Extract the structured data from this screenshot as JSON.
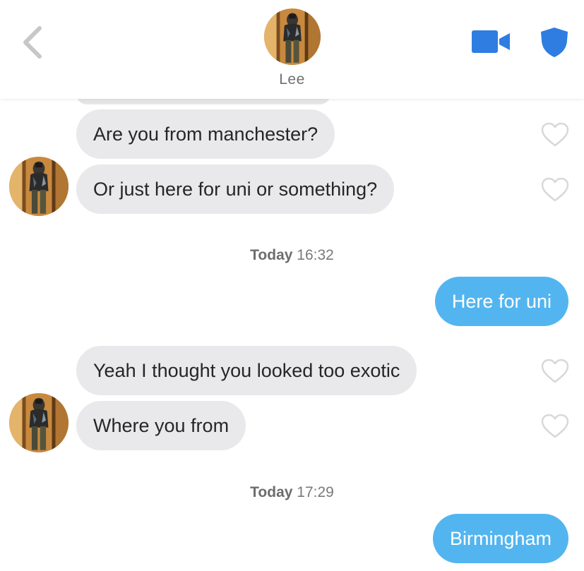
{
  "header": {
    "contact_name": "Lee",
    "back_icon": "chevron-left-icon",
    "video_icon": "video-camera-icon",
    "shield_icon": "shield-icon",
    "accent_color": "#2f7de1"
  },
  "messages": [
    {
      "from": "them",
      "text": "Are you from manchester?"
    },
    {
      "from": "them",
      "text": "Or just here for uni or something?"
    },
    {
      "type": "timestamp",
      "day": "Today",
      "time": "16:32"
    },
    {
      "from": "me",
      "text": "Here for uni"
    },
    {
      "from": "them",
      "text": "Yeah I thought you looked too exotic"
    },
    {
      "from": "them",
      "text": "Where you from"
    },
    {
      "type": "timestamp",
      "day": "Today",
      "time": "17:29"
    },
    {
      "from": "me",
      "text": "Birmingham"
    }
  ],
  "colors": {
    "incoming_bubble": "#e9e9eb",
    "outgoing_bubble": "#53b5f0",
    "like_heart_outline": "#d8d8d8"
  }
}
